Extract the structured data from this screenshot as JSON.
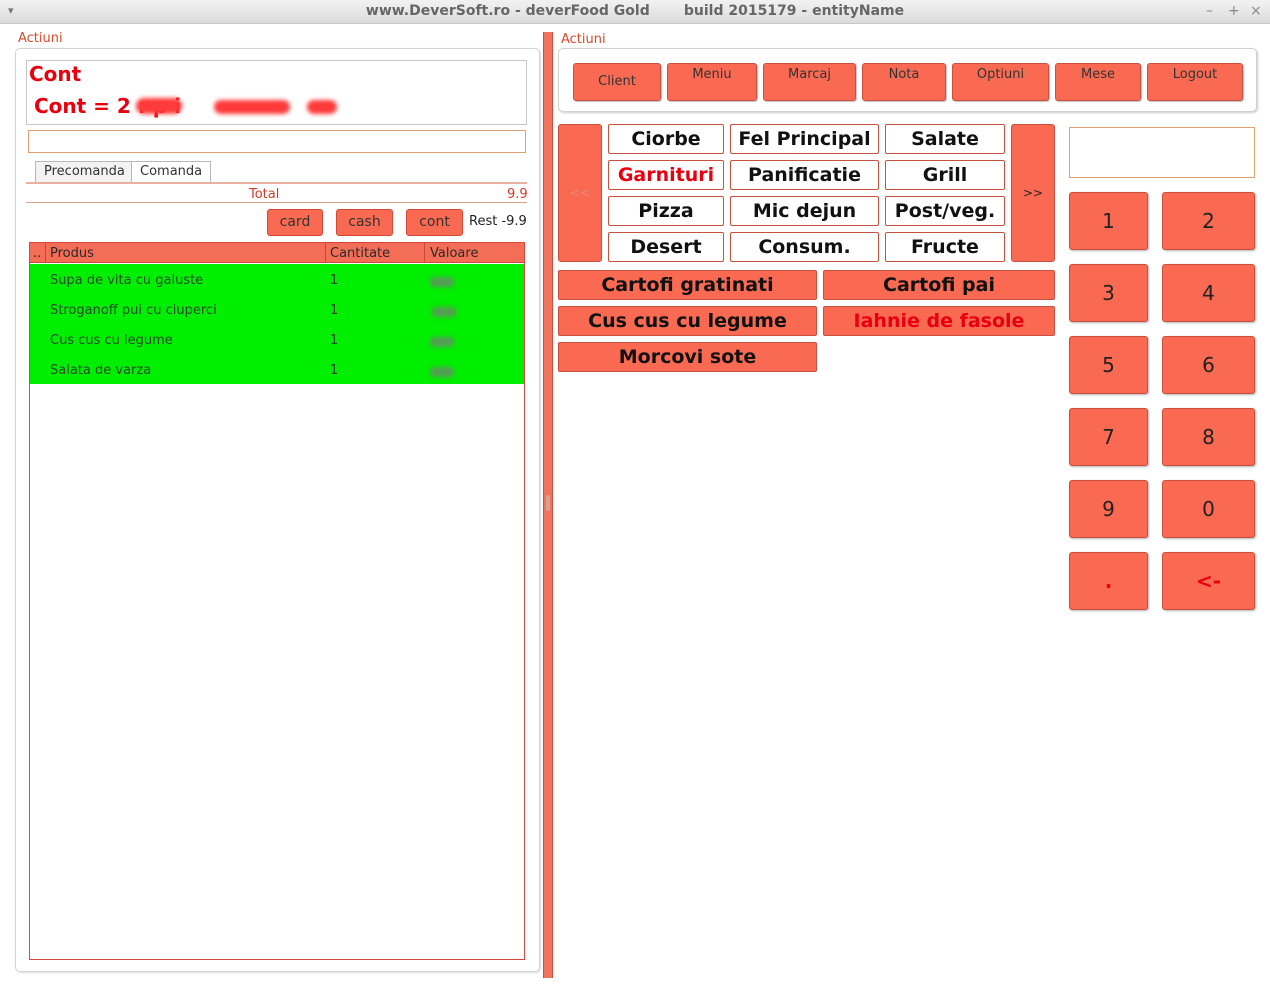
{
  "window": {
    "title": "www.DeverSoft.ro - deverFood Gold       build 2015179 - entityName",
    "menu_icon": "▾",
    "minimize": "–",
    "maximize": "+",
    "close": "×"
  },
  "left": {
    "section_label": "Actiuni",
    "cont_title": "Cont",
    "cont_line": "Cont = 2         :  p                 i",
    "cont_input_value": "",
    "tabs": [
      "Precomanda",
      "Comanda"
    ],
    "active_tab": "Comanda",
    "total_label": "Total",
    "total_value": "9.9",
    "pay_buttons": [
      "card",
      "cash",
      "cont"
    ],
    "rest_label": "Rest -9.9",
    "table": {
      "columns": [
        "..",
        "Produs",
        "Cantitate",
        "Valoare"
      ],
      "rows": [
        {
          "produs": "Supa de vita cu galuste",
          "cantitate": "1"
        },
        {
          "produs": "Stroganoff pui cu ciuperci",
          "cantitate": "1"
        },
        {
          "produs": "Cus cus cu legume",
          "cantitate": "1"
        },
        {
          "produs": "Salata de varza",
          "cantitate": "1"
        }
      ],
      "row_highlight_color": "#00ee00"
    }
  },
  "right": {
    "section_label": "Actiuni",
    "actions": [
      "Client",
      "Meniu",
      "Marcaj",
      "Nota",
      "Optiuni",
      "Mese",
      "Logout"
    ],
    "prev_label": "<<",
    "next_label": ">>",
    "categories": [
      [
        "Ciorbe",
        "Fel Principal",
        "Salate"
      ],
      [
        "Garnituri",
        "Panificatie",
        "Grill"
      ],
      [
        "Pizza",
        "Mic dejun",
        "Post/veg."
      ],
      [
        "Desert",
        "Consum.",
        "Fructe"
      ]
    ],
    "selected_category": "Garnituri",
    "products": [
      [
        "Cartofi gratinati",
        "Cartofi pai"
      ],
      [
        "Cus cus cu legume",
        "Iahnie de fasole"
      ],
      [
        "Morcovi sote"
      ]
    ],
    "selected_product": "Iahnie de fasole",
    "numpad_display": "",
    "numpad": [
      [
        "1",
        "2"
      ],
      [
        "3",
        "4"
      ],
      [
        "5",
        "6"
      ],
      [
        "7",
        "8"
      ],
      [
        "9",
        "0"
      ],
      [
        ".",
        "<-"
      ]
    ]
  },
  "colors": {
    "accent": "#fa6a52",
    "accent_border": "#c9503e",
    "alert_text": "#e8000f",
    "label_text": "#d64a2a"
  }
}
